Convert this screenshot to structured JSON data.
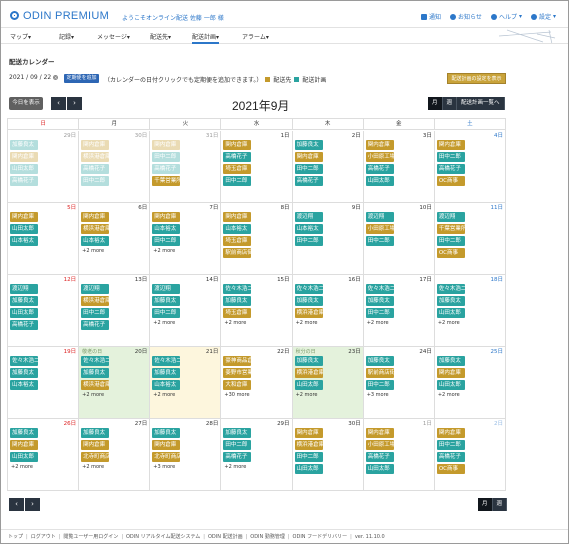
{
  "app": {
    "logo_text": "ODIN PREMIUM",
    "welcome": "ようこそオンライン配送 佐藤 一郎 様",
    "top_links": [
      {
        "label": "通知",
        "icon": "mail-icon"
      },
      {
        "label": "お知らせ",
        "icon": "info-icon"
      },
      {
        "label": "ヘルプ",
        "icon": "help-icon"
      },
      {
        "label": "設定",
        "icon": "gear-icon"
      }
    ]
  },
  "nav": [
    {
      "label": "マップ▾"
    },
    {
      "label": "記録▾"
    },
    {
      "label": "メッセージ▾"
    },
    {
      "label": "配送先▾"
    },
    {
      "label": "配送計画▾",
      "active": true
    },
    {
      "label": "アラーム▾"
    }
  ],
  "page": {
    "title": "配送カレンダー",
    "date_value": "2021 / 09 / 22",
    "add_button": "定期便を追加",
    "hint": "（カレンダーの日付クリックでも定期便を追加できます。）",
    "legend_dest": "配送先",
    "legend_plan": "配送計画",
    "setting_button": "配送計画の設定を表示"
  },
  "calendar": {
    "today_button": "今日を表示",
    "prev": "‹",
    "next": "›",
    "title": "2021年9月",
    "views": [
      "月",
      "週",
      "配送計画一覧へ"
    ],
    "bottom_views": [
      "月",
      "週"
    ],
    "dow": [
      "日",
      "月",
      "火",
      "水",
      "木",
      "金",
      "土"
    ],
    "weeks": [
      [
        {
          "day": "29日",
          "dim": true,
          "events": [
            [
              "加藤良太",
              "teal",
              1
            ],
            [
              "関内倉庫",
              "gold",
              1
            ],
            [
              "山田太郎",
              "teal",
              1
            ],
            [
              "高橋花子",
              "teal",
              1
            ]
          ]
        },
        {
          "day": "30日",
          "dim": true,
          "events": [
            [
              "関内倉庫",
              "gold",
              1
            ],
            [
              "横浜港倉庫",
              "gold",
              1
            ],
            [
              "高橋花子",
              "teal",
              1
            ],
            [
              "田中二郎",
              "teal",
              1
            ]
          ]
        },
        {
          "day": "31日",
          "dim": true,
          "events": [
            [
              "関内倉庫",
              "gold",
              1
            ],
            [
              "田中二郎",
              "teal",
              1
            ],
            [
              "高橋花子",
              "teal",
              1
            ],
            [
              "千葉営業所",
              "gold",
              0
            ]
          ]
        },
        {
          "day": "1日",
          "events": [
            [
              "関内倉庫",
              "gold",
              0
            ],
            [
              "高橋花子",
              "teal",
              0
            ],
            [
              "埼玉倉庫",
              "gold",
              0
            ],
            [
              "田中二郎",
              "teal",
              0
            ]
          ]
        },
        {
          "day": "2日",
          "events": [
            [
              "加藤良太",
              "teal",
              0
            ],
            [
              "関内倉庫",
              "gold",
              0
            ],
            [
              "田中二郎",
              "teal",
              0
            ],
            [
              "高橋花子",
              "teal",
              0
            ]
          ]
        },
        {
          "day": "3日",
          "events": [
            [
              "関内倉庫",
              "gold",
              0
            ],
            [
              "小田原工場",
              "gold",
              0
            ],
            [
              "高橋花子",
              "teal",
              0
            ],
            [
              "山田太郎",
              "teal",
              0
            ]
          ]
        },
        {
          "day": "4日",
          "sat": true,
          "events": [
            [
              "関内倉庫",
              "gold",
              0
            ],
            [
              "田中二郎",
              "teal",
              0
            ],
            [
              "高橋花子",
              "teal",
              0
            ],
            [
              "OC商事",
              "gold",
              0
            ]
          ]
        }
      ],
      [
        {
          "day": "5日",
          "sun": true,
          "events": [
            [
              "関内倉庫",
              "gold",
              0
            ],
            [
              "山田太郎",
              "teal",
              0
            ],
            [
              "山本裕太",
              "teal",
              0
            ]
          ]
        },
        {
          "day": "6日",
          "events": [
            [
              "関内倉庫",
              "gold",
              0
            ],
            [
              "横浜港倉庫",
              "gold",
              0
            ],
            [
              "山本裕太",
              "teal",
              0
            ]
          ],
          "more": "+2 more"
        },
        {
          "day": "7日",
          "events": [
            [
              "関内倉庫",
              "gold",
              0
            ],
            [
              "山本裕太",
              "teal",
              0
            ],
            [
              "田中二郎",
              "teal",
              0
            ]
          ],
          "more": "+2 more"
        },
        {
          "day": "8日",
          "events": [
            [
              "関内倉庫",
              "gold",
              0
            ],
            [
              "山本裕太",
              "teal",
              0
            ],
            [
              "埼玉倉庫",
              "gold",
              0
            ],
            [
              "駅前商店街",
              "gold",
              0
            ]
          ]
        },
        {
          "day": "9日",
          "events": [
            [
              "渡辺翔",
              "teal",
              0
            ],
            [
              "山本裕太",
              "teal",
              0
            ],
            [
              "田中二郎",
              "teal",
              0
            ]
          ]
        },
        {
          "day": "10日",
          "events": [
            [
              "渡辺翔",
              "teal",
              0
            ],
            [
              "小田原工場",
              "gold",
              0
            ],
            [
              "田中二郎",
              "teal",
              0
            ]
          ]
        },
        {
          "day": "11日",
          "sat": true,
          "events": [
            [
              "渡辺翔",
              "teal",
              0
            ],
            [
              "千葉営業所",
              "gold",
              0
            ],
            [
              "田中二郎",
              "teal",
              0
            ],
            [
              "OC商事",
              "gold",
              0
            ]
          ]
        }
      ],
      [
        {
          "day": "12日",
          "sun": true,
          "events": [
            [
              "渡辺翔",
              "teal",
              0
            ],
            [
              "加藤良太",
              "teal",
              0
            ],
            [
              "山田太郎",
              "teal",
              0
            ],
            [
              "高橋花子",
              "teal",
              0
            ]
          ]
        },
        {
          "day": "13日",
          "events": [
            [
              "渡辺翔",
              "teal",
              0
            ],
            [
              "横浜港倉庫",
              "gold",
              0
            ],
            [
              "田中二郎",
              "teal",
              0
            ],
            [
              "高橋花子",
              "teal",
              0
            ]
          ]
        },
        {
          "day": "14日",
          "events": [
            [
              "渡辺翔",
              "teal",
              0
            ],
            [
              "加藤良太",
              "teal",
              0
            ],
            [
              "田中二郎",
              "teal",
              0
            ]
          ],
          "more": "+2 more"
        },
        {
          "day": "15日",
          "events": [
            [
              "佐々木浩二",
              "teal",
              0
            ],
            [
              "加藤良太",
              "teal",
              0
            ],
            [
              "埼玉倉庫",
              "gold",
              0
            ]
          ],
          "more": "+2 more"
        },
        {
          "day": "16日",
          "events": [
            [
              "佐々木浩二",
              "teal",
              0
            ],
            [
              "加藤良太",
              "teal",
              0
            ],
            [
              "横浜港倉庫",
              "gold",
              0
            ]
          ],
          "more": "+2 more"
        },
        {
          "day": "17日",
          "events": [
            [
              "佐々木浩二",
              "teal",
              0
            ],
            [
              "加藤良太",
              "teal",
              0
            ],
            [
              "田中二郎",
              "teal",
              0
            ]
          ],
          "more": "+2 more"
        },
        {
          "day": "18日",
          "sat": true,
          "events": [
            [
              "佐々木浩二",
              "teal",
              0
            ],
            [
              "加藤良太",
              "teal",
              0
            ],
            [
              "山田太郎",
              "teal",
              0
            ]
          ],
          "more": "+2 more"
        }
      ],
      [
        {
          "day": "19日",
          "sun": true,
          "events": [
            [
              "佐々木浩二",
              "teal",
              0
            ],
            [
              "加藤良太",
              "teal",
              0
            ],
            [
              "山本裕太",
              "teal",
              0
            ]
          ]
        },
        {
          "day": "20日",
          "green": true,
          "holiday": "敬老の日",
          "events": [
            [
              "佐々木浩二",
              "teal",
              0
            ],
            [
              "加藤良太",
              "teal",
              0
            ],
            [
              "横浜港倉庫",
              "gold",
              0
            ]
          ],
          "more": "+2 more"
        },
        {
          "day": "21日",
          "yellow": true,
          "events": [
            [
              "佐々木浩二",
              "teal",
              0
            ],
            [
              "加藤良太",
              "teal",
              0
            ],
            [
              "山本裕太",
              "teal",
              0
            ]
          ],
          "more": "+2 more"
        },
        {
          "day": "22日",
          "events": [
            [
              "豪神商品倉庫",
              "gold",
              0
            ],
            [
              "姜野市営業所",
              "gold",
              0
            ],
            [
              "大和倉庫",
              "gold",
              0
            ]
          ],
          "more": "+30 more"
        },
        {
          "day": "23日",
          "green": true,
          "holiday": "秋分の日",
          "events": [
            [
              "加藤良太",
              "teal",
              0
            ],
            [
              "横浜港倉庫",
              "gold",
              0
            ],
            [
              "山田太郎",
              "teal",
              0
            ]
          ],
          "more": "+2 more"
        },
        {
          "day": "24日",
          "events": [
            [
              "加藤良太",
              "teal",
              0
            ],
            [
              "駅前商店街",
              "gold",
              0
            ],
            [
              "田中二郎",
              "teal",
              0
            ]
          ],
          "more": "+3 more"
        },
        {
          "day": "25日",
          "sat": true,
          "events": [
            [
              "加藤良太",
              "teal",
              0
            ],
            [
              "関内倉庫",
              "gold",
              0
            ],
            [
              "山田太郎",
              "teal",
              0
            ]
          ],
          "more": "+2 more"
        }
      ],
      [
        {
          "day": "26日",
          "sun": true,
          "events": [
            [
              "加藤良太",
              "teal",
              0
            ],
            [
              "関内倉庫",
              "gold",
              0
            ],
            [
              "山田太郎",
              "teal",
              0
            ]
          ],
          "more": "+2 more"
        },
        {
          "day": "27日",
          "events": [
            [
              "加藤良太",
              "teal",
              0
            ],
            [
              "関内倉庫",
              "gold",
              0
            ],
            [
              "北寺町商店",
              "gold",
              0
            ]
          ],
          "more": "+2 more"
        },
        {
          "day": "28日",
          "events": [
            [
              "加藤良太",
              "teal",
              0
            ],
            [
              "関内倉庫",
              "gold",
              0
            ],
            [
              "北寺町商店",
              "gold",
              0
            ]
          ],
          "more": "+3 more"
        },
        {
          "day": "29日",
          "events": [
            [
              "加藤良太",
              "teal",
              0
            ],
            [
              "田中二郎",
              "teal",
              0
            ],
            [
              "高橋花子",
              "teal",
              0
            ]
          ],
          "more": "+2 more"
        },
        {
          "day": "30日",
          "events": [
            [
              "関内倉庫",
              "gold",
              0
            ],
            [
              "横浜港倉庫",
              "gold",
              0
            ],
            [
              "田中二郎",
              "teal",
              0
            ],
            [
              "山田太郎",
              "teal",
              0
            ]
          ]
        },
        {
          "day": "1日",
          "dim": true,
          "events": [
            [
              "関内倉庫",
              "gold",
              0
            ],
            [
              "小田原工場",
              "gold",
              0
            ],
            [
              "高橋花子",
              "teal",
              0
            ],
            [
              "山田太郎",
              "teal",
              0
            ]
          ]
        },
        {
          "day": "2日",
          "dim": true,
          "sat": true,
          "events": [
            [
              "関内倉庫",
              "gold",
              0
            ],
            [
              "田中二郎",
              "teal",
              0
            ],
            [
              "高橋花子",
              "teal",
              0
            ],
            [
              "OC商事",
              "gold",
              0
            ]
          ]
        }
      ]
    ]
  },
  "footer": [
    "トップ",
    "ログアウト",
    "閲覧ユーザー用ログイン",
    "ODIN リアルタイム配送システム",
    "ODIN 配送計画",
    "ODIN 勤務管理",
    "ODIN フードデリバリー",
    "ver. 11.10.0"
  ],
  "colors": {
    "accent": "#2c77c9",
    "teal": "#2aa3a0",
    "gold": "#c49a2c",
    "dark": "#2a3440"
  }
}
